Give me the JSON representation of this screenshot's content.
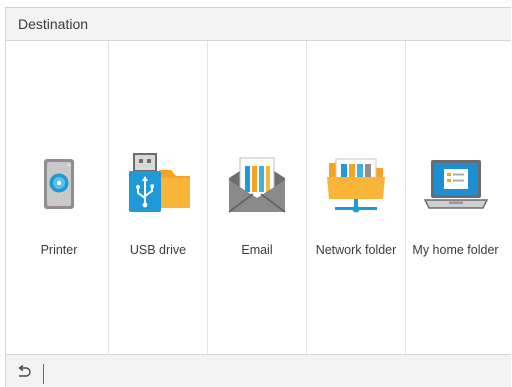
{
  "header": {
    "title": "Destination"
  },
  "destinations": [
    {
      "label": "Printer",
      "icon": "printer-disc-icon"
    },
    {
      "label": "USB drive",
      "icon": "usb-drive-icon"
    },
    {
      "label": "Email",
      "icon": "email-icon"
    },
    {
      "label": "Network folder",
      "icon": "network-folder-icon"
    },
    {
      "label": "My home folder",
      "icon": "laptop-icon"
    }
  ],
  "footer": {
    "back_icon": "back-arrow-icon"
  },
  "colors": {
    "header_bg": "#f3f3f3",
    "folder_orange": "#f6a325",
    "usb_blue": "#1e9ad6",
    "screen_blue": "#1f8fd3",
    "text": "#3b3b3b"
  }
}
